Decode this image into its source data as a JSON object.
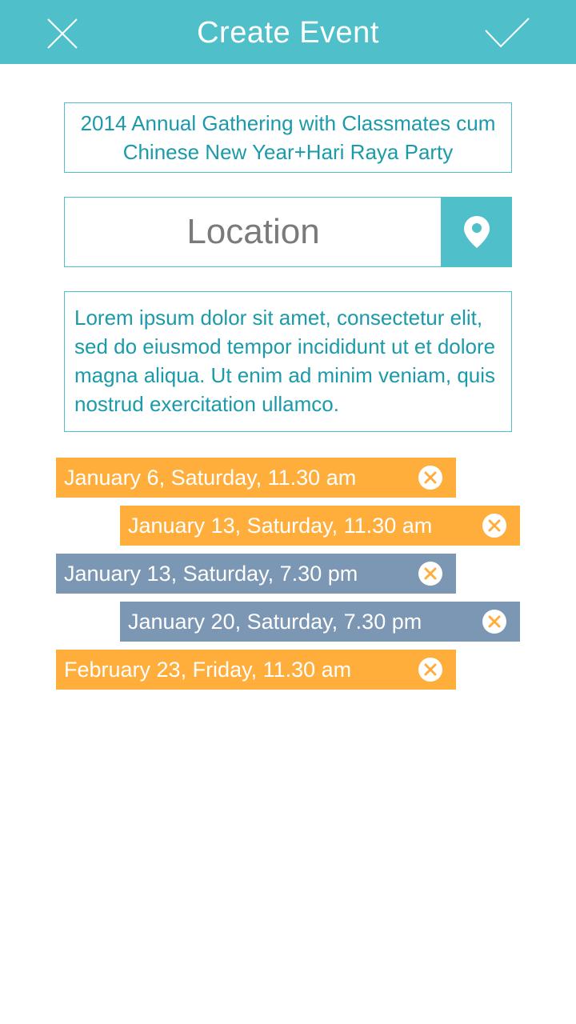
{
  "header": {
    "title": "Create Event"
  },
  "event": {
    "title": "2014 Annual Gathering with Classmates cum Chinese New Year+Hari Raya Party",
    "location_placeholder": "Location",
    "description": "Lorem ipsum dolor sit amet, consectetur elit, sed do eiusmod tempor incididunt ut et dolore magna aliqua. Ut enim ad minim veniam, quis nostrud exercitation ullamco."
  },
  "dates": [
    {
      "label": "January 6, Saturday, 11.30 am",
      "color": "#ffad3b"
    },
    {
      "label": "January 13, Saturday, 11.30 am",
      "color": "#ffad3b"
    },
    {
      "label": "January 13, Saturday, 7.30 pm",
      "color": "#7b97b4"
    },
    {
      "label": "January 20, Saturday, 7.30 pm",
      "color": "#7b97b4"
    },
    {
      "label": "February 23, Friday, 11.30 am",
      "color": "#ffad3b"
    }
  ],
  "icons": {
    "close": "close-icon",
    "confirm": "check-icon",
    "location": "map-pin-icon",
    "remove": "remove-circle-icon"
  },
  "colors": {
    "accent": "#4fbfca",
    "text_accent": "#1b9aa9",
    "chip_orange": "#ffad3b",
    "chip_gray": "#7b97b4"
  }
}
